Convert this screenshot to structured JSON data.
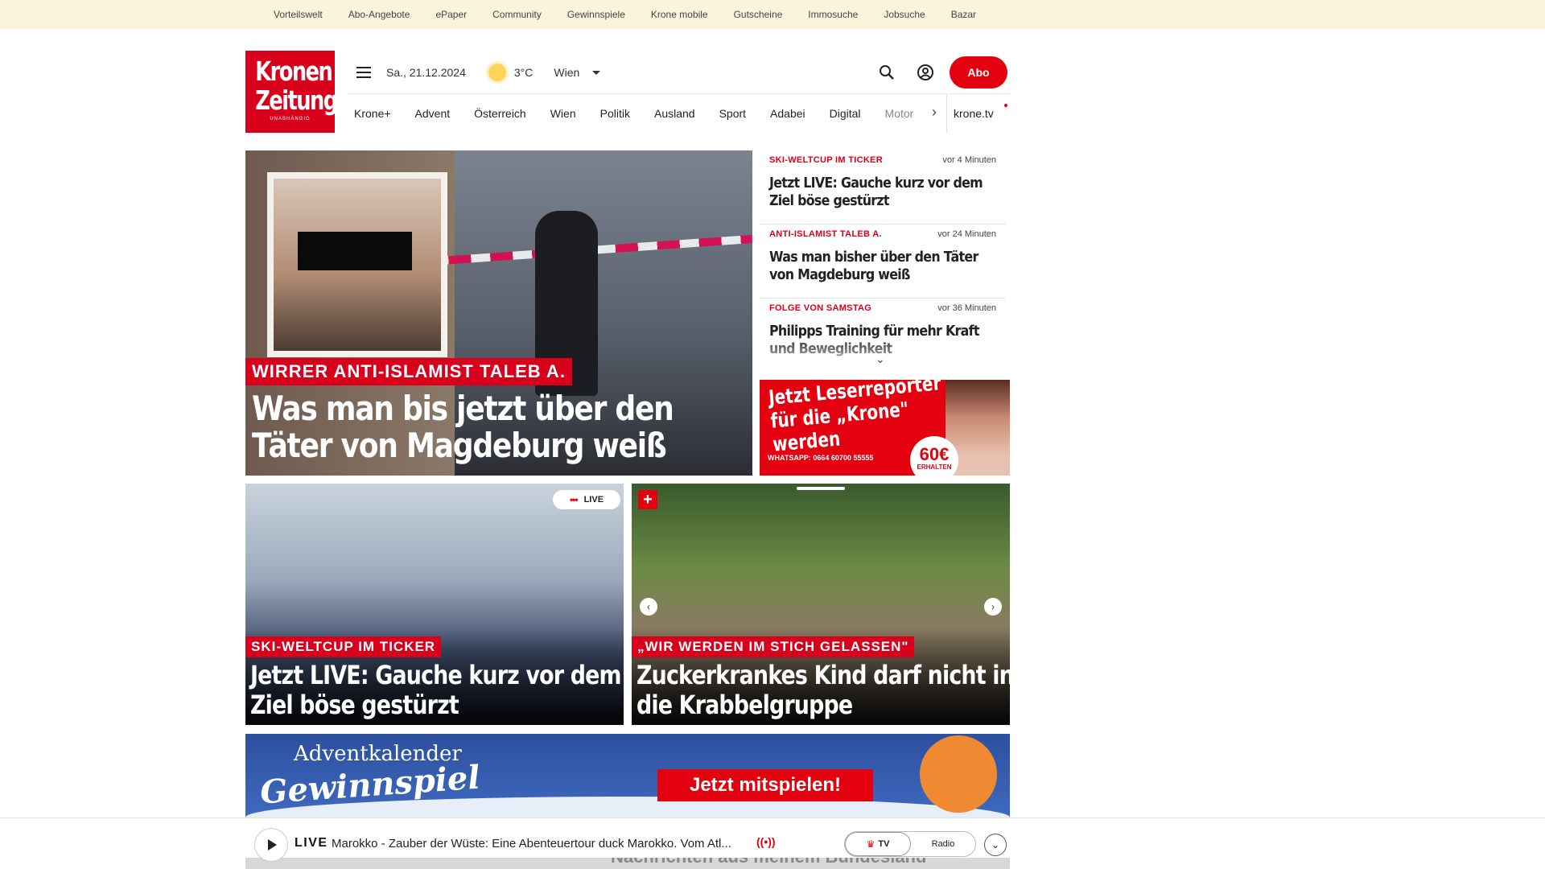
{
  "topbar": [
    "Vorteilswelt",
    "Abo-Angebote",
    "ePaper",
    "Community",
    "Gewinnspiele",
    "Krone mobile",
    "Gutscheine",
    "Immosuche",
    "Jobsuche",
    "Bazar"
  ],
  "logo": {
    "line1": "Kronen",
    "line2": "Zeitung",
    "tagline": "UNABHÄNGIG"
  },
  "header": {
    "date": "Sa., 21.12.2024",
    "temperature": "3°C",
    "city": "Wien",
    "abo_label": "Abo"
  },
  "nav": {
    "items": [
      "Krone+",
      "Advent",
      "Österreich",
      "Wien",
      "Politik",
      "Ausland",
      "Sport",
      "Adabei",
      "Digital",
      "Motor"
    ],
    "tv_label": "krone.tv"
  },
  "hero": {
    "kicker": "WIRRER ANTI-ISLAMIST TALEB A.",
    "headline": "Was man bis jetzt über den Täter von Magdeburg weiß"
  },
  "ticker": [
    {
      "kicker": "SKI-WELTCUP IM TICKER",
      "time": "vor 4 Minuten",
      "title": "Jetzt LIVE: Gauche kurz vor dem Ziel böse gestürzt"
    },
    {
      "kicker": "ANTI-ISLAMIST TALEB A.",
      "time": "vor 24 Minuten",
      "title": "Was man bisher über den Täter von Magdeburg weiß"
    },
    {
      "kicker": "FOLGE VON SAMSTAG",
      "time": "vor 36 Minuten",
      "title": "Philipps Training für mehr Kraft und Beweglichkeit"
    }
  ],
  "ad_reporter": {
    "text": "Jetzt Leserreporter für die „Krone\" werden",
    "whatsapp": "WHATSAPP: 0664 60700 55555",
    "badge_amount": "60€",
    "badge_label": "ERHALTEN"
  },
  "cards": [
    {
      "kicker": "SKI-WELTCUP IM TICKER",
      "headline": "Jetzt LIVE: Gauche kurz vor dem Ziel böse gestürzt",
      "live_label": "LIVE"
    },
    {
      "kicker": "„WIR WERDEN IM STICH GELASSEN\"",
      "headline": "Zuckerkrankes Kind darf nicht in die Krabbelgruppe",
      "plus_label": "+"
    }
  ],
  "ad_banner": {
    "line1": "Adventkalender",
    "line2": "Gewinnspiel",
    "cta": "Jetzt mitspielen!"
  },
  "bottom_strip": {
    "text": "Nachrichten aus meinem Bundesland"
  },
  "player": {
    "live_label": "LIVE",
    "song": "Marokko - Zauber der Wüste: Eine Abenteuertour duck Marokko. Vom Atl...",
    "tv_label": "TV",
    "radio_label": "Radio"
  }
}
